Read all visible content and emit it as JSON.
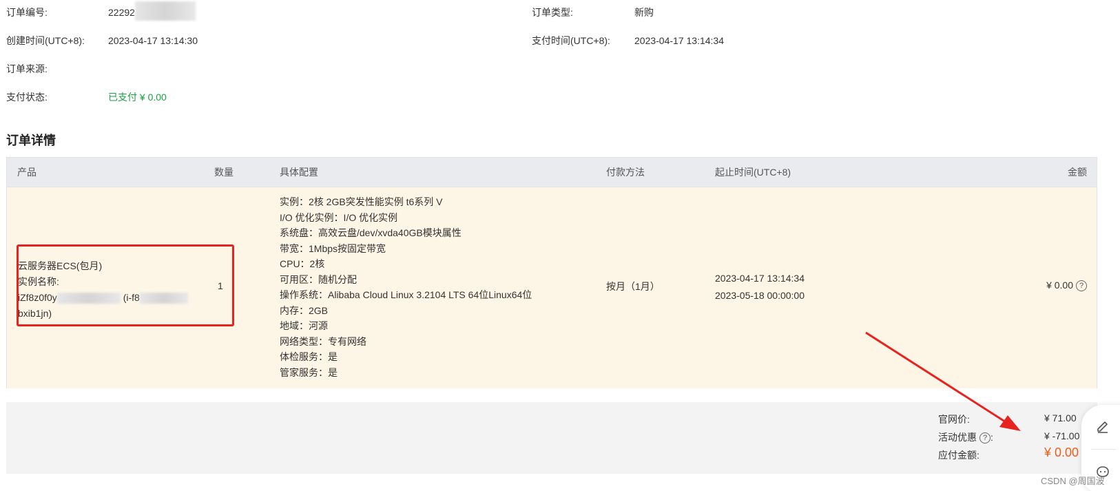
{
  "order_info": {
    "order_no_label": "订单编号:",
    "order_no_value": "22292",
    "order_type_label": "订单类型:",
    "order_type_value": "新购",
    "created_label": "创建时间(UTC+8):",
    "created_value": "2023-04-17 13:14:30",
    "paid_time_label": "支付时间(UTC+8):",
    "paid_time_value": "2023-04-17 13:14:34",
    "source_label": "订单来源:",
    "status_label": "支付状态:",
    "status_value": "已支付 ¥ 0.00"
  },
  "details_title": "订单详情",
  "table": {
    "headers": {
      "product": "产品",
      "quantity": "数量",
      "config": "具体配置",
      "payment": "付款方法",
      "period": "起止时间(UTC+8)",
      "amount": "金额"
    },
    "row": {
      "product_name": "云服务器ECS(包月)",
      "instance_label": "实例名称:",
      "instance_prefix": "iZf8z0f0y",
      "instance_mid": "(i-f8",
      "instance_suffix": "bxib1jn)",
      "quantity": "1",
      "config": [
        "实例：2核 2GB突发性能实例 t6系列 V",
        "I/O 优化实例：I/O 优化实例",
        "系统盘：高效云盘/dev/xvda40GB模块属性",
        "带宽：1Mbps按固定带宽",
        "CPU：2核",
        "可用区：随机分配",
        "操作系统：Alibaba Cloud Linux 3.2104 LTS 64位Linux64位",
        "内存：2GB",
        "地域：河源",
        "网络类型：专有网络",
        "体检服务：是",
        "管家服务：是"
      ],
      "payment": "按月（1月）",
      "start": "2023-04-17 13:14:34",
      "end": "2023-05-18 00:00:00",
      "amount": "¥ 0.00"
    }
  },
  "summary": {
    "list_price_label": "官网价:",
    "list_price_value": "¥ 71.00",
    "discount_label": "活动优惠",
    "discount_colon": ":",
    "discount_value": "¥ -71.00",
    "due_label": "应付金额:",
    "due_value": "¥ 0.00"
  },
  "watermark": "CSDN @周国波",
  "colors": {
    "paid_green": "#19a23f",
    "due_orange": "#f25c19",
    "row_bg": "#fdf6e6",
    "highlight_red": "#e8221f"
  },
  "icons": [
    "help-icon",
    "edit-icon",
    "chat-icon",
    "arrow-annotation"
  ]
}
